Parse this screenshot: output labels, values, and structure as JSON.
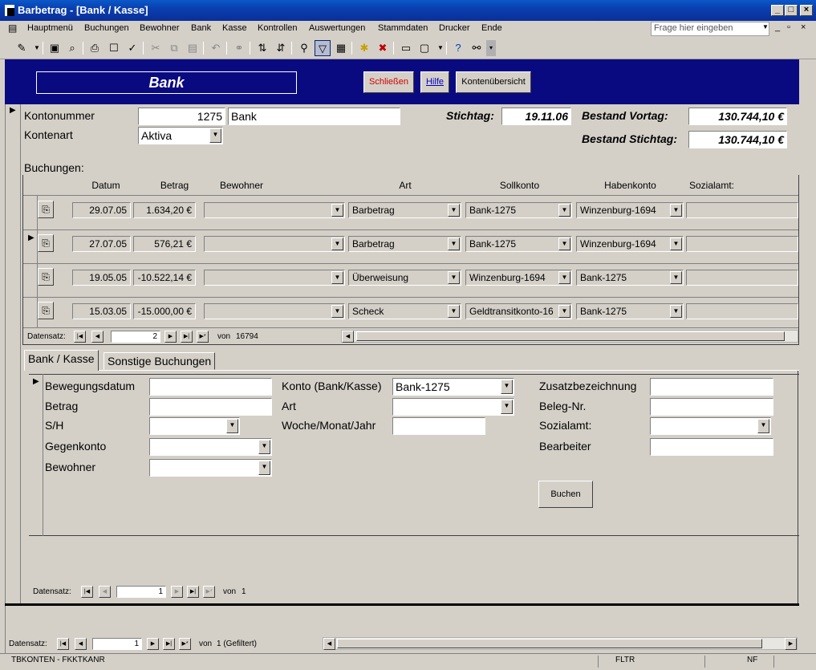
{
  "window": {
    "title": "Barbetrag - [Bank / Kasse]"
  },
  "menu": {
    "items": [
      "Hauptmenü",
      "Buchungen",
      "Bewohner",
      "Bank",
      "Kasse",
      "Kontrollen",
      "Auswertungen",
      "Stammdaten",
      "Drucker",
      "Ende"
    ],
    "help_placeholder": "Frage hier eingeben"
  },
  "header": {
    "title": "Bank",
    "close_label": "Schließen",
    "help_label": "Hilfe",
    "overview_label": "Kontenübersicht",
    "colors": {
      "band": "#0a0a80",
      "close_text": "#d00000",
      "help_text": "#0000c0"
    }
  },
  "account": {
    "number_label": "Kontonummer",
    "number": "1275",
    "name": "Bank",
    "type_label": "Kontenart",
    "type": "Aktiva",
    "stichtag_label": "Stichtag:",
    "stichtag": "19.11.06",
    "bestand_vortag_label": "Bestand Vortag:",
    "bestand_vortag": "130.744,10 €",
    "bestand_stichtag_label": "Bestand Stichtag:",
    "bestand_stichtag": "130.744,10 €"
  },
  "buchungen": {
    "label": "Buchungen:",
    "columns": [
      "Datum",
      "Betrag",
      "Bewohner",
      "Art",
      "Sollkonto",
      "Habenkonto",
      "Sozialamt:"
    ],
    "rows": [
      {
        "datum": "29.07.05",
        "betrag": "1.634,20 €",
        "bewohner": "",
        "art": "Barbetrag",
        "soll": "Bank-1275",
        "haben": "Winzenburg-1694",
        "sozialamt": ""
      },
      {
        "datum": "27.07.05",
        "betrag": "576,21 €",
        "bewohner": "",
        "art": "Barbetrag",
        "soll": "Bank-1275",
        "haben": "Winzenburg-1694",
        "sozialamt": ""
      },
      {
        "datum": "19.05.05",
        "betrag": "-10.522,14 €",
        "bewohner": "",
        "art": "Überweisung",
        "soll": "Winzenburg-1694",
        "haben": "Bank-1275",
        "sozialamt": ""
      },
      {
        "datum": "15.03.05",
        "betrag": "-15.000,00 €",
        "bewohner": "",
        "art": "Scheck",
        "soll": "Geldtransitkonto-16",
        "haben": "Bank-1275",
        "sozialamt": ""
      }
    ],
    "nav": {
      "label": "Datensatz:",
      "current": "2",
      "of_label": "von",
      "total": "16794"
    }
  },
  "tabs": {
    "items": [
      "Bank / Kasse",
      "Sonstige Buchungen"
    ]
  },
  "entry_form": {
    "bewegungsdatum_label": "Bewegungsdatum",
    "bewegungsdatum": "",
    "betrag_label": "Betrag",
    "betrag": "",
    "sh_label": "S/H",
    "sh": "",
    "gegenkonto_label": "Gegenkonto",
    "gegenkonto": "",
    "bewohner_label": "Bewohner",
    "bewohner": "",
    "konto_label": "Konto (Bank/Kasse)",
    "konto": "Bank-1275",
    "art_label": "Art",
    "art": "",
    "woche_label": "Woche/Monat/Jahr",
    "woche": "",
    "zusatz_label": "Zusatzbezeichnung",
    "zusatz": "",
    "beleg_label": "Beleg-Nr.",
    "beleg": "",
    "sozialamt_label": "Sozialamt:",
    "sozialamt": "",
    "bearbeiter_label": "Bearbeiter",
    "bearbeiter": "",
    "buchen_label": "Buchen",
    "nav": {
      "label": "Datensatz:",
      "current": "1",
      "of_label": "von",
      "total": "1"
    }
  },
  "main_nav": {
    "label": "Datensatz:",
    "current": "1",
    "of_label": "von",
    "total": "1 (Gefiltert)"
  },
  "status": {
    "left": "TBKONTEN - FKKTKANR",
    "fltr": "FLTR",
    "nf": "NF"
  },
  "icons": {
    "nav_first": "first-record-icon",
    "nav_prev": "prev-record-icon",
    "nav_next": "next-record-icon",
    "nav_last": "last-record-icon",
    "nav_new": "new-record-icon"
  }
}
